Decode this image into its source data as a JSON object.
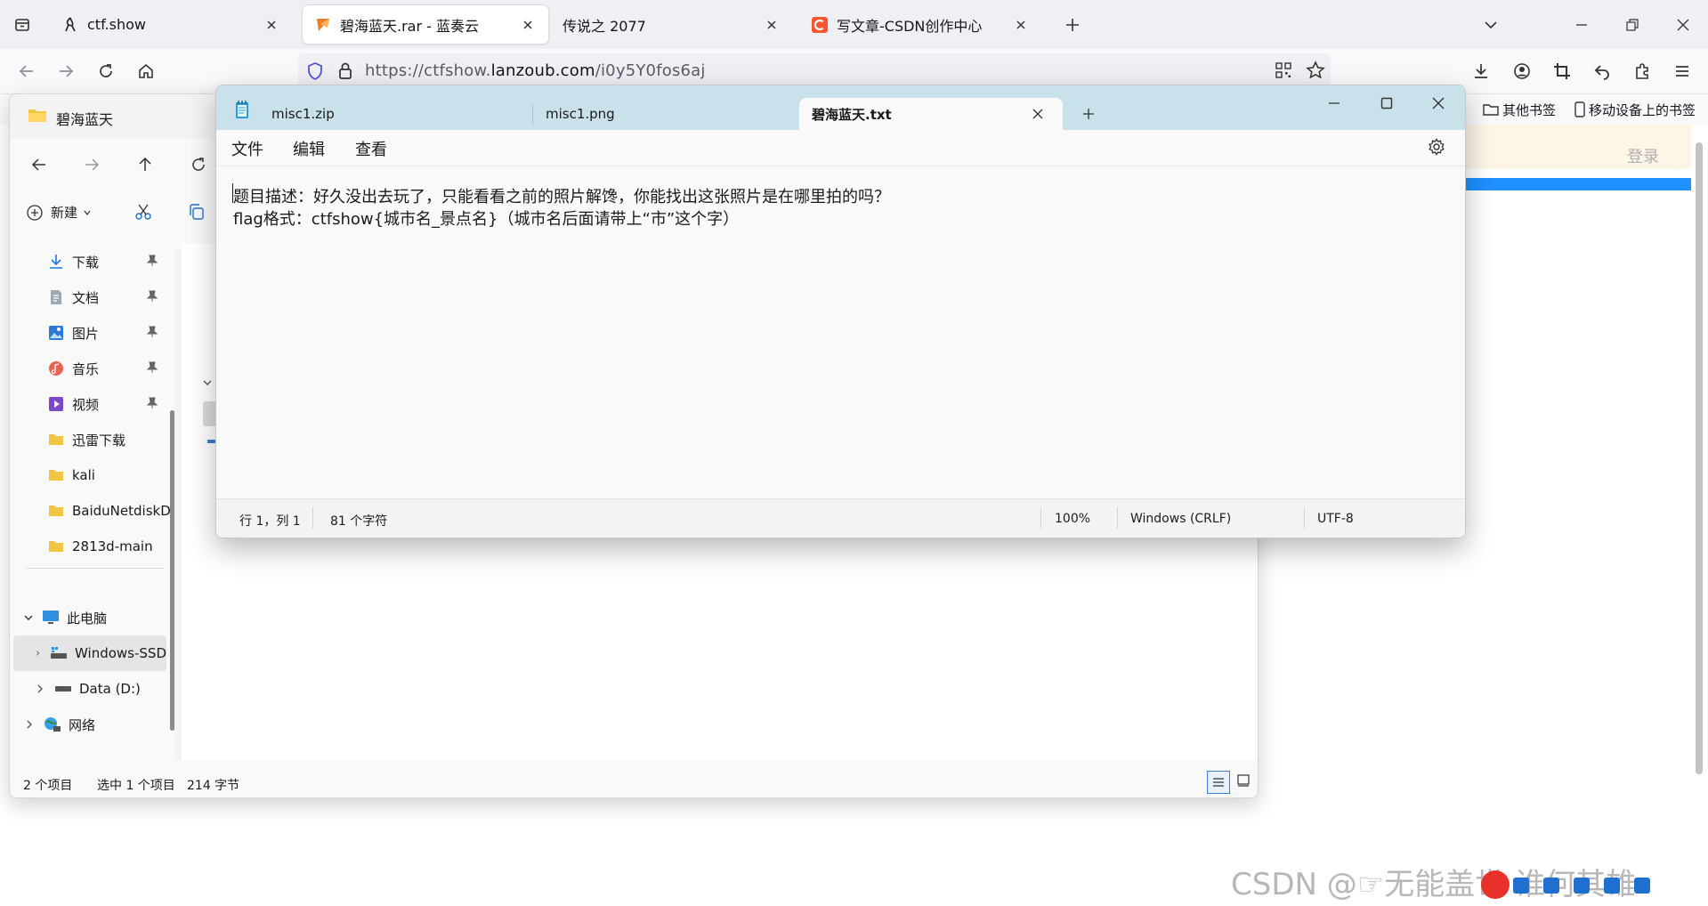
{
  "browser": {
    "tabs": [
      {
        "title": "ctf.show",
        "active": false
      },
      {
        "title": "碧海蓝天.rar - 蓝奏云",
        "active": true
      },
      {
        "title": "传说之 2077",
        "active": false
      },
      {
        "title": "写文章-CSDN创作中心",
        "active": false
      }
    ],
    "url_prefix": "https://ctfshow.",
    "url_domain": "lanzoub.com",
    "url_path": "/i0y5Y0fos6aj",
    "bookmarks": {
      "other": "其他书签",
      "mobile": "移动设备上的书签"
    },
    "site_login": "登录"
  },
  "explorer": {
    "title": "碧海蓝天",
    "new_label": "新建",
    "nav_items": [
      {
        "label": "下载",
        "icon": "download-icon"
      },
      {
        "label": "文档",
        "icon": "document-icon"
      },
      {
        "label": "图片",
        "icon": "picture-icon"
      },
      {
        "label": "音乐",
        "icon": "music-icon"
      },
      {
        "label": "视频",
        "icon": "video-icon"
      },
      {
        "label": "迅雷下载",
        "icon": "folder-icon"
      },
      {
        "label": "kali",
        "icon": "folder-icon"
      },
      {
        "label": "BaiduNetdiskD",
        "icon": "folder-icon"
      },
      {
        "label": "2813d-main",
        "icon": "folder-icon"
      }
    ],
    "this_pc": "此电脑",
    "drives": [
      {
        "label": "Windows-SSD"
      },
      {
        "label": "Data (D:)"
      }
    ],
    "network": "网络",
    "status_items": "2 个项目",
    "status_selected": "选中 1 个项目",
    "status_size": "214 字节"
  },
  "notepad": {
    "tabs": [
      {
        "title": "misc1.zip"
      },
      {
        "title": "misc1.png"
      },
      {
        "title": "碧海蓝天.txt"
      }
    ],
    "menu": {
      "file": "文件",
      "edit": "编辑",
      "view": "查看"
    },
    "lines": [
      "题目描述：好久没出去玩了，只能看看之前的照片解馋，你能找出这张照片是在哪里拍的吗？",
      "flag格式：ctfshow{城市名_景点名}（城市名后面请带上“市”这个字）"
    ],
    "status": {
      "position": "行 1，列 1",
      "chars": "81 个字符",
      "zoom": "100%",
      "line_ending": "Windows (CRLF)",
      "encoding": "UTF-8"
    }
  },
  "watermark": "CSDN @☞无能盖世  谁何其雄",
  "colors": {
    "accent": "#1e90ff",
    "notepad_tabbar": "#c9e1ea",
    "csdn": "#fc5531"
  }
}
